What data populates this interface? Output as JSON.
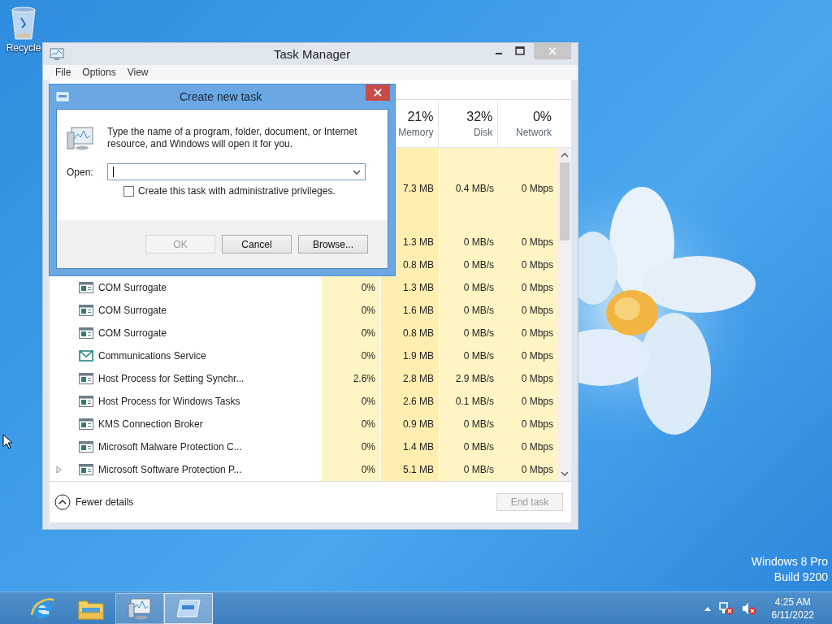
{
  "desktop": {
    "icons": [
      {
        "label": "Recycle"
      }
    ],
    "edition": [
      "Windows 8 Pro",
      "Build 9200"
    ]
  },
  "task_manager": {
    "title": "Task Manager",
    "menu": [
      "File",
      "Options",
      "View"
    ],
    "columns": [
      {
        "percent": "21%",
        "label": "Memory"
      },
      {
        "percent": "32%",
        "label": "Disk"
      },
      {
        "percent": "0%",
        "label": "Network"
      }
    ],
    "rows": [
      {
        "kind": "covered",
        "memory": "7.3 MB",
        "disk": "0.4 MB/s",
        "network": "0 Mbps"
      },
      {
        "kind": "covered",
        "memory": "1.3 MB",
        "disk": "0 MB/s",
        "network": "0 Mbps"
      },
      {
        "kind": "covered",
        "memory": "0.8 MB",
        "disk": "0 MB/s",
        "network": "0 Mbps"
      },
      {
        "kind": "app",
        "name": "COM Surrogate",
        "cpu": "0%",
        "memory": "1.3 MB",
        "disk": "0 MB/s",
        "network": "0 Mbps",
        "expandable": false
      },
      {
        "kind": "app",
        "name": "COM Surrogate",
        "cpu": "0%",
        "memory": "1.6 MB",
        "disk": "0 MB/s",
        "network": "0 Mbps",
        "expandable": false
      },
      {
        "kind": "app",
        "name": "COM Surrogate",
        "cpu": "0%",
        "memory": "0.8 MB",
        "disk": "0 MB/s",
        "network": "0 Mbps",
        "expandable": false
      },
      {
        "kind": "mail",
        "name": "Communications Service",
        "cpu": "0%",
        "memory": "1.9 MB",
        "disk": "0 MB/s",
        "network": "0 Mbps",
        "expandable": false
      },
      {
        "kind": "app",
        "name": "Host Process for Setting Synchr...",
        "cpu": "2.6%",
        "memory": "2.8 MB",
        "disk": "2.9 MB/s",
        "network": "0 Mbps",
        "expandable": false
      },
      {
        "kind": "app",
        "name": "Host Process for Windows Tasks",
        "cpu": "0%",
        "memory": "2.6 MB",
        "disk": "0.1 MB/s",
        "network": "0 Mbps",
        "expandable": false
      },
      {
        "kind": "app",
        "name": "KMS Connection Broker",
        "cpu": "0%",
        "memory": "0.9 MB",
        "disk": "0 MB/s",
        "network": "0 Mbps",
        "expandable": false
      },
      {
        "kind": "app",
        "name": "Microsoft Malware Protection C...",
        "cpu": "0%",
        "memory": "1.4 MB",
        "disk": "0 MB/s",
        "network": "0 Mbps",
        "expandable": false
      },
      {
        "kind": "app",
        "name": "Microsoft Software Protection P...",
        "cpu": "0%",
        "memory": "5.1 MB",
        "disk": "0 MB/s",
        "network": "0 Mbps",
        "expandable": true
      }
    ],
    "footer": {
      "toggle": "Fewer details",
      "end_task": {
        "label": "End task",
        "disabled": true
      }
    }
  },
  "dialog": {
    "title": "Create new task",
    "description": "Type the name of a program, folder, document, or Internet resource, and Windows will open it for you.",
    "open_label": "Open:",
    "admin": {
      "label": "Create this task with administrative privileges.",
      "checked": false
    },
    "buttons": [
      {
        "label": "OK",
        "disabled": true
      },
      {
        "label": "Cancel",
        "disabled": false
      },
      {
        "label": "Browse...",
        "disabled": false
      }
    ]
  },
  "taskbar": {
    "apps": [
      {
        "kind": "browser",
        "running": false,
        "selected": false
      },
      {
        "kind": "folder",
        "running": false,
        "selected": false
      },
      {
        "kind": "task-manager",
        "running": true,
        "selected": false
      },
      {
        "kind": "run",
        "running": true,
        "selected": true
      }
    ],
    "clock": {
      "time": "4:25 AM",
      "date": "6/11/2022"
    }
  }
}
